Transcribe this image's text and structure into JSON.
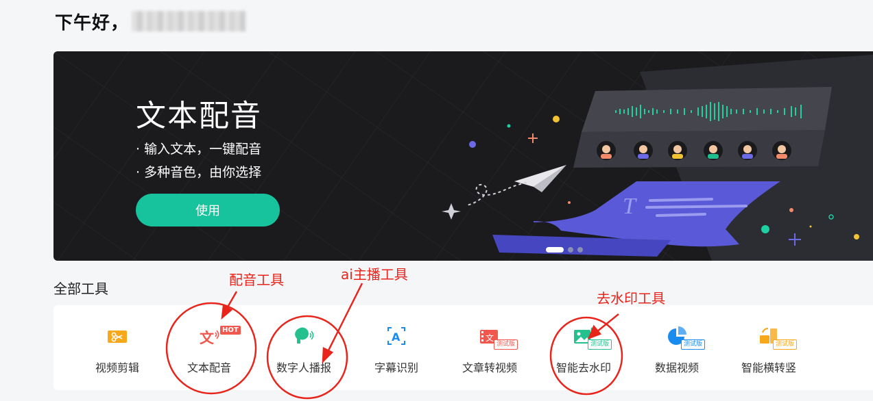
{
  "greeting": {
    "text": "下午好，"
  },
  "banner": {
    "title": "文本配音",
    "bullets": [
      "· 输入文本，一键配音",
      "· 多种音色，由你选择"
    ],
    "cta_label": "使用",
    "carousel": {
      "count": 3,
      "active_index": 0
    }
  },
  "tools_section": {
    "title": "全部工具",
    "items": [
      {
        "label": "视频剪辑",
        "icon": "scissors-icon",
        "tag": ""
      },
      {
        "label": "文本配音",
        "icon": "text-voice-icon",
        "tag": "HOT"
      },
      {
        "label": "数字人播报",
        "icon": "digital-human-icon",
        "tag": ""
      },
      {
        "label": "字幕识别",
        "icon": "subtitle-recognition-icon",
        "tag": ""
      },
      {
        "label": "文章转视频",
        "icon": "article-to-video-icon",
        "tag": "测试版"
      },
      {
        "label": "智能去水印",
        "icon": "watermark-remove-icon",
        "tag": "测试版"
      },
      {
        "label": "数据视频",
        "icon": "pie-chart-icon",
        "tag": "测试版"
      },
      {
        "label": "智能横转竖",
        "icon": "landscape-to-portrait-icon",
        "tag": "测试版"
      }
    ]
  },
  "annotations": {
    "dubbing": "配音工具",
    "ai_anchor": "ai主播工具",
    "watermark": "去水印工具"
  },
  "colors": {
    "accent": "#17c39c",
    "annotation": "#e8241b",
    "hot": "#f2574d",
    "banner_bg": "#1b1b1e"
  }
}
